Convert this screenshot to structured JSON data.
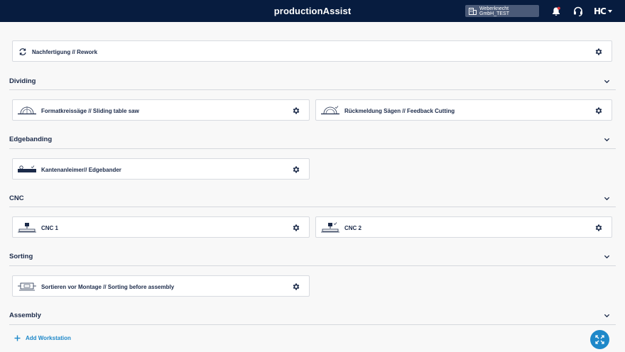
{
  "header": {
    "title": "productionAssist",
    "tenant": "Weberknecht GmbH_TEST",
    "brand": "HC"
  },
  "rework": {
    "label": "Nachfertigung // Rework"
  },
  "sections": {
    "dividing": {
      "title": "Dividing",
      "cards": [
        {
          "label": "Formatkreissäge // Sliding table saw"
        },
        {
          "label": "Rückmeldung Sägen // Feedback Cutting"
        }
      ]
    },
    "edgebanding": {
      "title": "Edgebanding",
      "cards": [
        {
          "label": "Kantenanleimer// Edgebander"
        }
      ]
    },
    "cnc": {
      "title": "CNC",
      "cards": [
        {
          "label": "CNC 1"
        },
        {
          "label": "CNC 2"
        }
      ]
    },
    "sorting": {
      "title": "Sorting",
      "cards": [
        {
          "label": "Sortieren vor Montage // Sorting before assembly"
        }
      ]
    },
    "assembly": {
      "title": "Assembly"
    }
  },
  "footer": {
    "add_label": "Add Workstation"
  },
  "colors": {
    "header_bg": "#071c3f",
    "accent": "#1e88c9",
    "text": "#1c2b4a"
  }
}
